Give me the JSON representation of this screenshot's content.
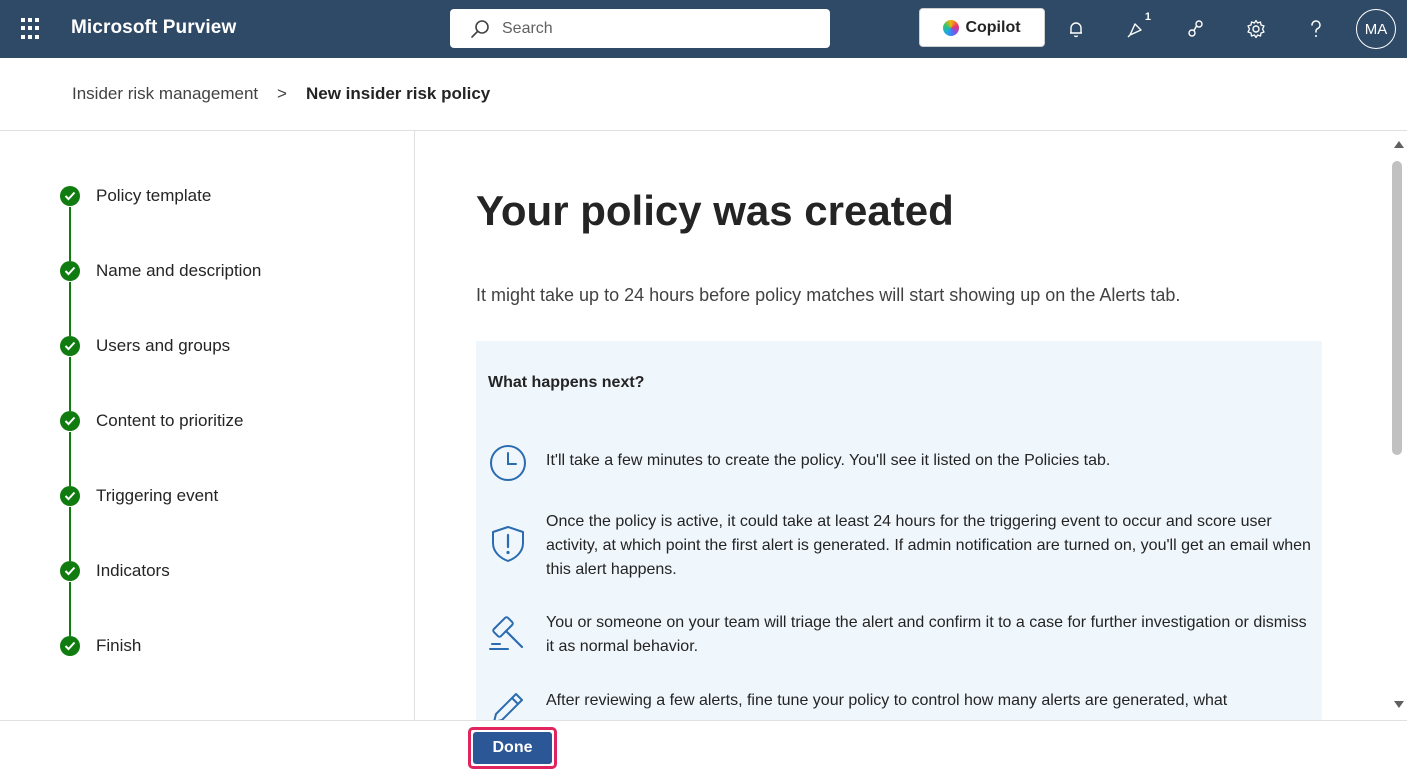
{
  "app": {
    "title": "Microsoft Purview"
  },
  "search": {
    "placeholder": "Search"
  },
  "header": {
    "copilot_label": "Copilot",
    "notification_badge": "1",
    "avatar_initials": "MA"
  },
  "breadcrumb": {
    "parent": "Insider risk management",
    "separator": ">",
    "current": "New insider risk policy"
  },
  "steps": [
    {
      "label": "Policy template",
      "status": "complete"
    },
    {
      "label": "Name and description",
      "status": "complete"
    },
    {
      "label": "Users and groups",
      "status": "complete"
    },
    {
      "label": "Content to prioritize",
      "status": "complete"
    },
    {
      "label": "Triggering event",
      "status": "complete"
    },
    {
      "label": "Indicators",
      "status": "complete"
    },
    {
      "label": "Finish",
      "status": "complete"
    }
  ],
  "main": {
    "heading": "Your policy was created",
    "subtext": "It might take up to 24 hours before policy matches will start showing up on the Alerts tab.",
    "panel": {
      "title": "What happens next?",
      "items": [
        {
          "icon": "clock-icon",
          "text": "It'll take a few minutes to create the policy. You'll see it listed on the Policies tab."
        },
        {
          "icon": "shield-alert-icon",
          "text": "Once the policy is active, it could take at least 24 hours for the triggering event to occur and score user activity, at which point the first alert is generated. If admin notification are turned on, you'll get an email when this alert happens."
        },
        {
          "icon": "gavel-icon",
          "text": "You or someone on your team will triage the alert and confirm it to a case for further investigation or dismiss it as normal behavior."
        },
        {
          "icon": "pencil-icon",
          "text": "After reviewing a few alerts, fine tune your policy to control how many alerts are generated, what"
        }
      ]
    }
  },
  "footer": {
    "done_label": "Done"
  },
  "colors": {
    "topbar": "#2f4a66",
    "step_complete": "#107c10",
    "panel_bg": "#eff6fc",
    "primary_button": "#2b5797",
    "highlight_outline": "#e0245e"
  }
}
